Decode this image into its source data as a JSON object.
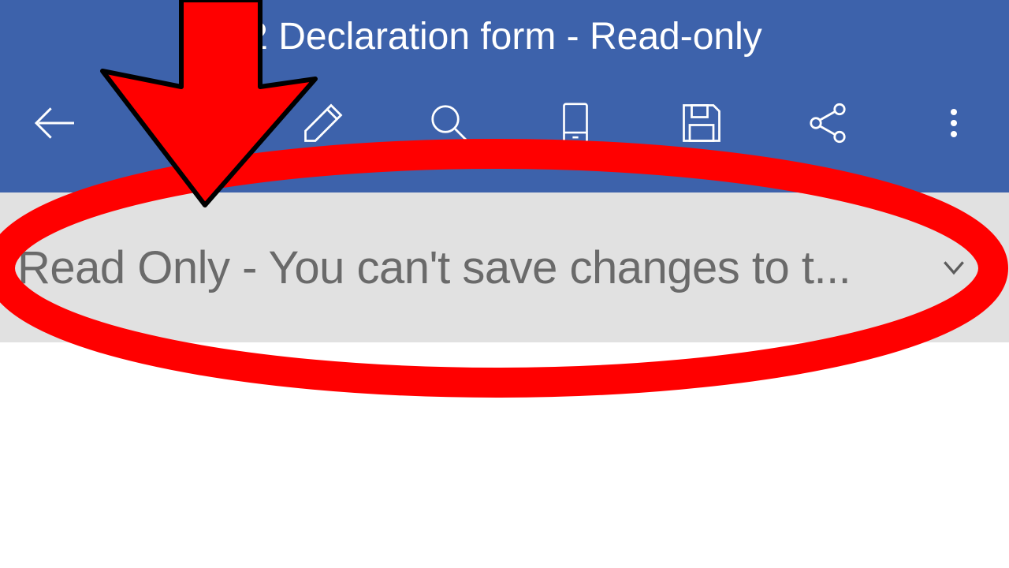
{
  "colors": {
    "header_bg": "#3d62ab",
    "notice_bg": "#e1e1e1",
    "annotation_red": "#ff0000"
  },
  "title": "2 Declaration form - Read-only",
  "toolbar": {
    "back": {
      "name": "back-icon"
    },
    "edit": {
      "name": "pencil-icon"
    },
    "search": {
      "name": "search-icon"
    },
    "mobile": {
      "name": "mobile-view-icon"
    },
    "save": {
      "name": "save-icon"
    },
    "share": {
      "name": "share-icon"
    },
    "more": {
      "name": "more-vertical-icon"
    }
  },
  "notice": {
    "text": "Read Only - You can't save changes to t...",
    "chevron": "chevron-down-icon"
  }
}
